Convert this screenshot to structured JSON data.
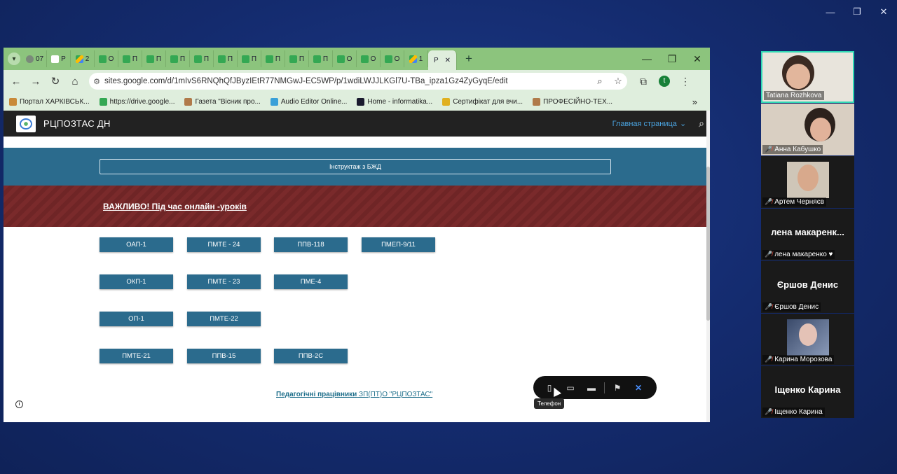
{
  "os": {
    "minimize": "—",
    "maximize": "❐",
    "close": "✕"
  },
  "browser": {
    "tabs": [
      {
        "label": "07",
        "icon": "gray"
      },
      {
        "label": "P",
        "icon": "red"
      },
      {
        "label": "2",
        "icon": "drive"
      },
      {
        "label": "O",
        "icon": "green"
      },
      {
        "label": "П",
        "icon": "green"
      },
      {
        "label": "П",
        "icon": "green"
      },
      {
        "label": "П",
        "icon": "green"
      },
      {
        "label": "П",
        "icon": "green"
      },
      {
        "label": "П",
        "icon": "green"
      },
      {
        "label": "П",
        "icon": "green"
      },
      {
        "label": "П",
        "icon": "green"
      },
      {
        "label": "П",
        "icon": "green"
      },
      {
        "label": "П",
        "icon": "green"
      },
      {
        "label": "О",
        "icon": "green"
      },
      {
        "label": "О",
        "icon": "green"
      },
      {
        "label": "О",
        "icon": "green"
      },
      {
        "label": "1",
        "icon": "drive"
      }
    ],
    "active_tab": {
      "label": "Р",
      "close": "✕"
    },
    "new_tab": "+",
    "url": "sites.google.com/d/1mIvS6RNQhQfJByzIEtR77NMGwJ-EC5WP/p/1wdiLWJJLKGl7U-TBa_ipza1Gz4ZyGyqE/edit",
    "bookmarks": [
      {
        "label": "Портал ХАРКІВСЬК...",
        "color": "#c98a3a"
      },
      {
        "label": "https://drive.google...",
        "color": "#34a853"
      },
      {
        "label": "Газета \"Вісник про...",
        "color": "#b07a4a"
      },
      {
        "label": "Audio Editor Online...",
        "color": "#3aa0d8"
      },
      {
        "label": "Home - informatika...",
        "color": "#1a1a2e"
      },
      {
        "label": "Сертифікат для вчи...",
        "color": "#e0b020"
      },
      {
        "label": "ПРОФЕСІЙНО-ТЕХ...",
        "color": "#b07a4a"
      }
    ],
    "bookmarks_more": "»"
  },
  "site": {
    "name": "РЦПОЗТАС ДН",
    "nav_label": "Главная страница",
    "bjd_button": "Інструктаж з БЖД",
    "important": "ВАЖЛИВО!  Під час онлайн -уроків",
    "groups": [
      [
        "ОАП-1",
        "ПМТЕ - 24",
        "ППВ-118",
        "ПМЕП-9/11"
      ],
      [
        "ОКП-1",
        "ПМТЕ - 23",
        "ПМЕ-4"
      ],
      [
        "ОП-1",
        "ПМТЕ-22"
      ],
      [
        "ПМТЕ-21",
        "ППВ-15",
        "ППВ-2С"
      ]
    ],
    "staff_link_bold": "Педагогічні працівники",
    "staff_link_rest": " ЗП(ПТ)О \"РЦПОЗТАС\""
  },
  "share_toolbar": {
    "tooltip": "Телефон"
  },
  "participants": [
    {
      "name": "Tatiana Rozhkova",
      "muted": false,
      "active": true
    },
    {
      "name": "Анна Кабушко",
      "muted": true
    },
    {
      "name": "Артем Черняєв",
      "muted": true
    },
    {
      "name": "лена макаренко ♥",
      "big": "лена  макаренк...",
      "muted": true
    },
    {
      "name": "Єршов Денис",
      "big": "Єршов Денис",
      "muted": true
    },
    {
      "name": "Карина Морозова",
      "muted": true
    },
    {
      "name": "Іщенко Карина",
      "big": "Іщенко Карина",
      "muted": true
    }
  ]
}
